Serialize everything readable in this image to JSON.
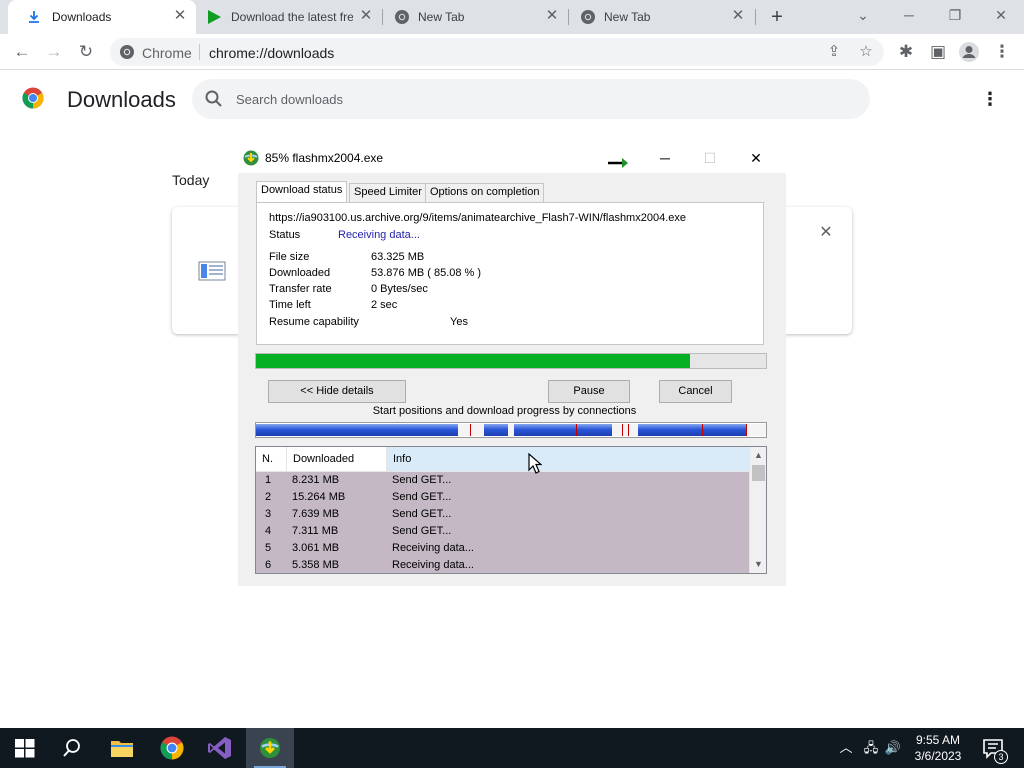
{
  "browser": {
    "tabs": [
      {
        "label": "Downloads",
        "icon": "download-icon",
        "active": true
      },
      {
        "label": "Download the latest fre",
        "icon": "play-icon",
        "active": false
      },
      {
        "label": "New Tab",
        "icon": "chrome-icon",
        "active": false
      },
      {
        "label": "New Tab",
        "icon": "chrome-icon",
        "active": false
      }
    ],
    "new_tab_label": "+",
    "omnibox": {
      "site_chip": "Chrome",
      "url": "chrome://downloads"
    }
  },
  "downloads_page": {
    "title": "Downloads",
    "search_placeholder": "Search downloads",
    "section_label": "Today"
  },
  "idm": {
    "title": "85% flashmx2004.exe",
    "tabs": [
      "Download status",
      "Speed Limiter",
      "Options on completion"
    ],
    "url": "https://ia903100.us.archive.org/9/items/animatearchive_Flash7-WIN/flashmx2004.exe",
    "status_label": "Status",
    "status_value": "Receiving data...",
    "fields": [
      {
        "label": "File size",
        "value": "63.325  MB"
      },
      {
        "label": "Downloaded",
        "value": "53.876  MB  ( 85.08 % )"
      },
      {
        "label": "Transfer rate",
        "value": "0  Bytes/sec"
      },
      {
        "label": "Time left",
        "value": "2 sec"
      }
    ],
    "resume_label": "Resume capability",
    "resume_value": "Yes",
    "progress_fraction": 0.8508,
    "buttons": {
      "hide_details": "<< Hide details",
      "pause": "Pause",
      "cancel": "Cancel"
    },
    "connections_caption": "Start positions and download progress by connections",
    "columns": [
      "N.",
      "Downloaded",
      "Info"
    ],
    "rows": [
      {
        "n": "1",
        "downloaded": "8.231  MB",
        "info": "Send GET..."
      },
      {
        "n": "2",
        "downloaded": "15.264  MB",
        "info": "Send GET..."
      },
      {
        "n": "3",
        "downloaded": "7.639  MB",
        "info": "Send GET..."
      },
      {
        "n": "4",
        "downloaded": "7.311  MB",
        "info": "Send GET..."
      },
      {
        "n": "5",
        "downloaded": "3.061  MB",
        "info": "Receiving data..."
      },
      {
        "n": "6",
        "downloaded": "5.358  MB",
        "info": "Receiving data..."
      }
    ],
    "colors": {
      "progress": "#06b025",
      "rows_background": "#c4b8c5",
      "status_value": "#1f1fa8"
    }
  },
  "taskbar": {
    "time": "9:55 AM",
    "date": "3/6/2023",
    "notification_count": "3"
  }
}
